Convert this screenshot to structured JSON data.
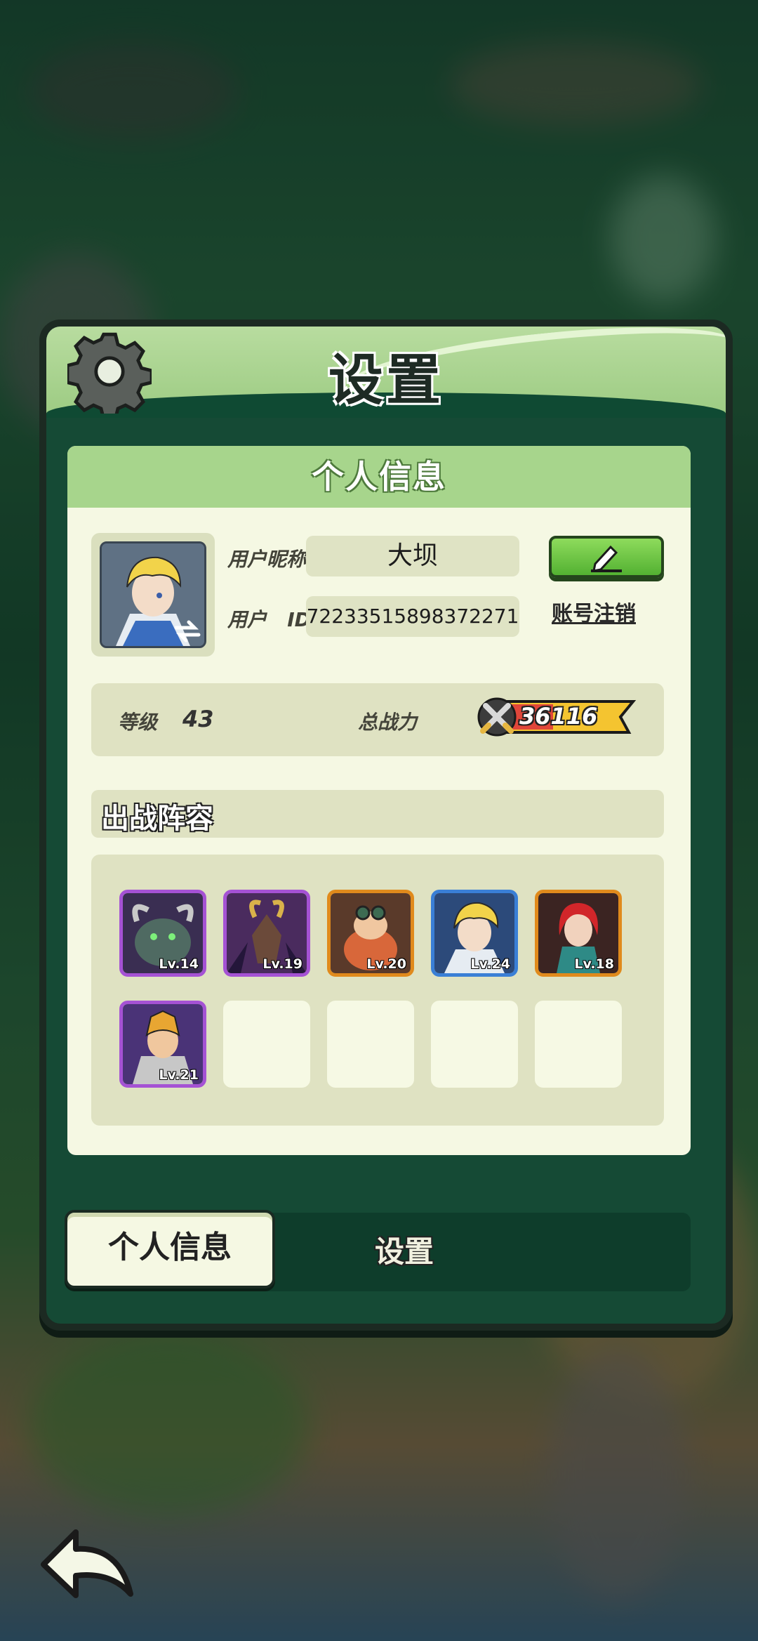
{
  "dialog": {
    "title": "设置"
  },
  "panel": {
    "header": "个人信息",
    "nickname_label": "用户昵称",
    "nickname": "大坝",
    "id_label": "用户   ID",
    "user_id": "72233515898372271",
    "delete_account": "账号注销",
    "level_label": "等级",
    "level": "43",
    "power_label": "总战力",
    "power": "36116",
    "lineup_title": "出战阵容",
    "heroes": [
      {
        "level": "Lv.14",
        "icon": "horned-beast-hero",
        "rarity_color": "#a552d4"
      },
      {
        "level": "Lv.19",
        "icon": "goat-demon-hero",
        "rarity_color": "#a552d4"
      },
      {
        "level": "Lv.20",
        "icon": "dwarf-engineer-hero",
        "rarity_color": "#e08a1c"
      },
      {
        "level": "Lv.24",
        "icon": "blond-swordsman-hero",
        "rarity_color": "#3a7fd6"
      },
      {
        "level": "Lv.18",
        "icon": "red-hair-mage-hero",
        "rarity_color": "#e08a1c"
      },
      {
        "level": "Lv.21",
        "icon": "armored-knight-hero",
        "rarity_color": "#a552d4"
      }
    ]
  },
  "tabs": {
    "active": "个人信息",
    "other": "设置"
  }
}
